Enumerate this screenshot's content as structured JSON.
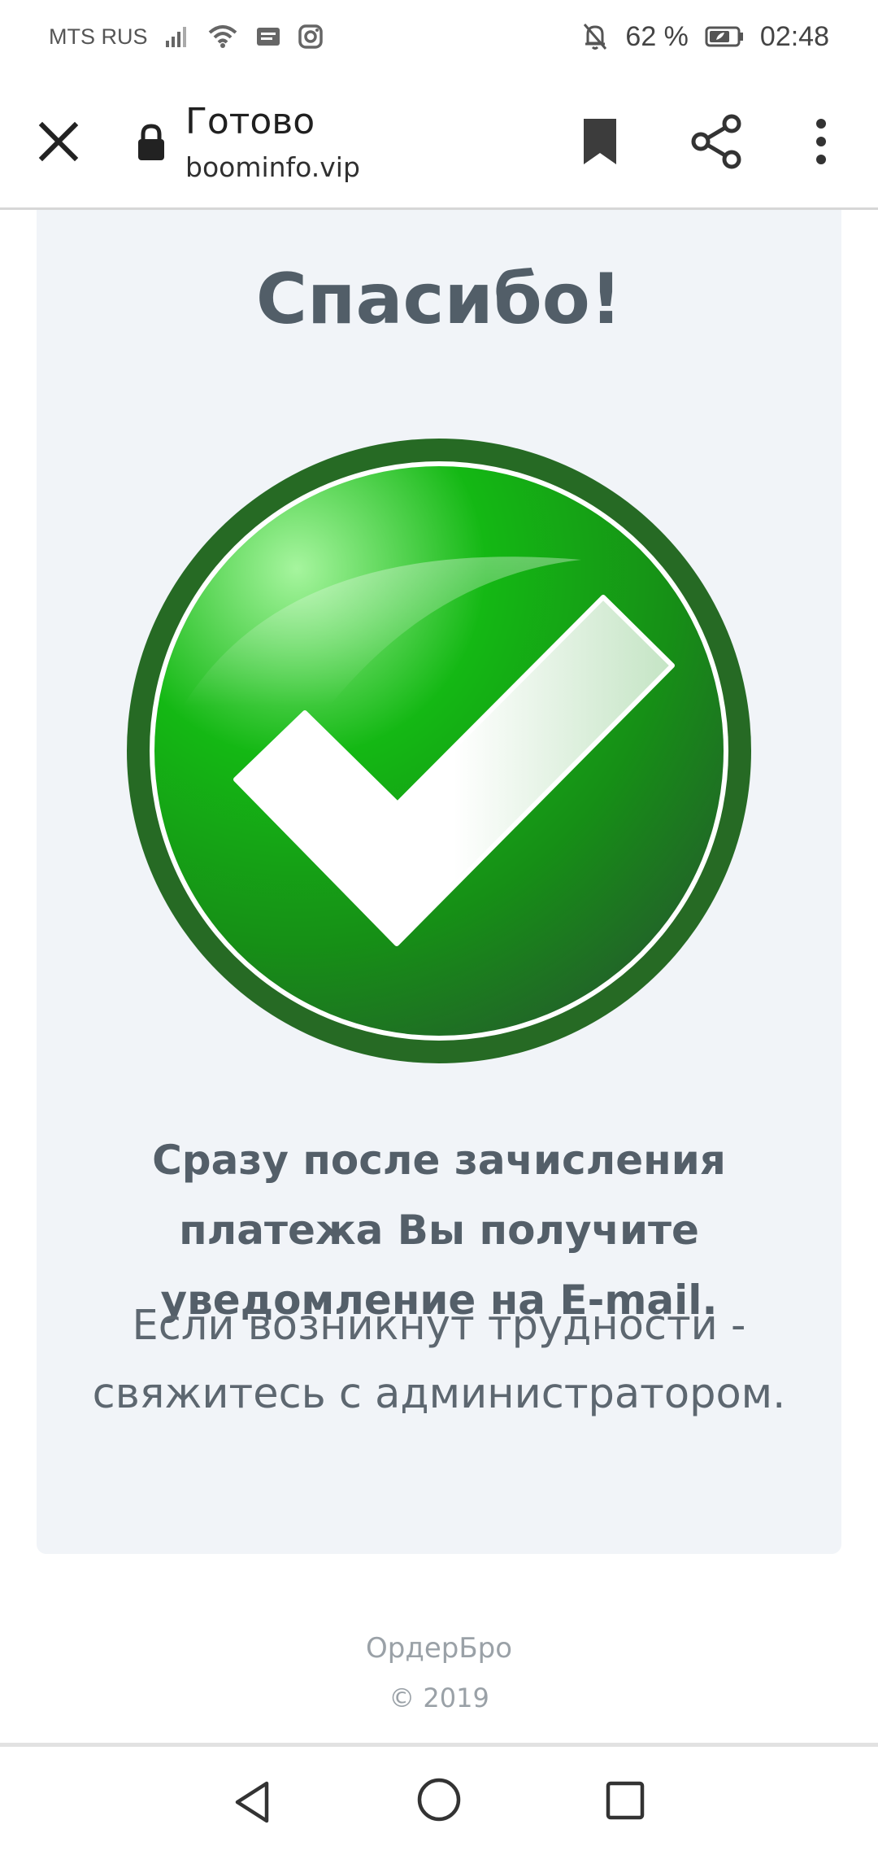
{
  "status_bar": {
    "carrier": "MTS RUS",
    "battery": "62 %",
    "time": "02:48"
  },
  "toolbar": {
    "title": "Готово",
    "url": "boominfo.vip"
  },
  "content": {
    "heading": "Спасибо!",
    "bold_lines": [
      "Сразу после зачисления",
      "платежа Вы получите",
      "уведомление на E-mail."
    ],
    "regular_lines": [
      "Если возникнут трудности -",
      "свяжитесь с администратором."
    ]
  },
  "footer": {
    "brand": "ОрдерБро",
    "copyright": "© 2019"
  },
  "colors": {
    "card_bg": "#f1f4f8",
    "heading": "#525e68",
    "check_dark": "#266a24",
    "check_mid": "#14b514"
  },
  "icons": {
    "close": "close-icon",
    "lock": "lock-icon",
    "bookmark": "bookmark-icon",
    "share": "share-icon",
    "menu": "more-vert-icon"
  }
}
